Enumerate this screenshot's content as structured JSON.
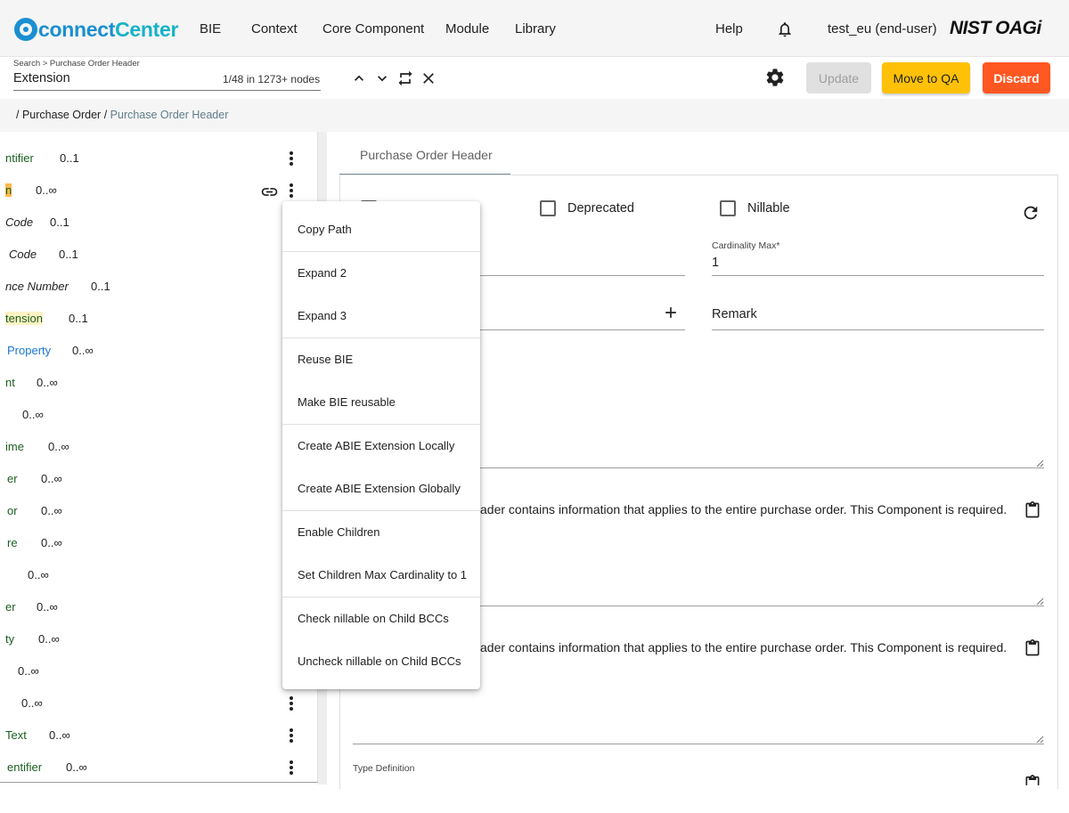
{
  "app": {
    "logo_part1": "connect",
    "logo_part2": "Center",
    "brand_colors": {
      "primary": "#1a8fd1",
      "accent": "#16b3c8"
    }
  },
  "nav": {
    "items": [
      "BIE",
      "Context",
      "Core Component",
      "Module",
      "Library"
    ],
    "help": "Help",
    "user": "test_eu (end-user)",
    "org_logo": "NIST OAGi"
  },
  "search": {
    "caption": "Search > Purchase Order Header",
    "value": "Extension",
    "count": "1/48 in 1273+ nodes"
  },
  "toolbar": {
    "update_label": "Update",
    "qa_label": "Move to QA",
    "discard_label": "Discard",
    "colors": {
      "qa": "#ffc107",
      "discard": "#ff5722",
      "update_disabled": "#e0e0e0"
    }
  },
  "breadcrumb": {
    "sep": "/",
    "parent": "Purchase Order",
    "current": "Purchase Order Header"
  },
  "tree": {
    "rows": [
      {
        "name": "ntifier",
        "card": "0..1"
      },
      {
        "name": "n",
        "card": "0..∞"
      },
      {
        "name": "Code",
        "card": "0..1"
      },
      {
        "name": "Code",
        "card": "0..1"
      },
      {
        "name": "nce Number",
        "card": "0..1"
      },
      {
        "name": "tension",
        "card": "0..1"
      },
      {
        "name": "Property",
        "card": "0..∞"
      },
      {
        "name": "nt",
        "card": "0..∞"
      },
      {
        "name": "",
        "card": "0..∞"
      },
      {
        "name": "ime",
        "card": "0..∞"
      },
      {
        "name": "er",
        "card": "0..∞"
      },
      {
        "name": "or",
        "card": "0..∞"
      },
      {
        "name": "re",
        "card": "0..∞"
      },
      {
        "name": "",
        "card": "0..∞"
      },
      {
        "name": "er",
        "card": "0..∞"
      },
      {
        "name": "ty",
        "card": "0..∞"
      },
      {
        "name": "",
        "card": "0..∞"
      },
      {
        "name": "",
        "card": "0..∞"
      },
      {
        "name": "Text",
        "card": "0..∞"
      },
      {
        "name": "entifier",
        "card": "0..∞"
      }
    ]
  },
  "detail": {
    "tab": "Purchase Order Header",
    "deprecated_label": "Deprecated",
    "nillable_label": "Nillable",
    "card_max_label": "Cardinality Max*",
    "card_max_value": "1",
    "remark_placeholder": "Remark",
    "definition_text": "ader contains information that applies to the entire purchase order.  This Component is required.",
    "definition_text_2": "ader contains information that applies to the entire purchase order.  This Component is required.",
    "type_definition_label": "Type Definition"
  },
  "context_menu": {
    "items": [
      "Copy Path",
      "Expand 2",
      "Expand 3",
      "Reuse BIE",
      "Make BIE reusable",
      "Create ABIE Extension Locally",
      "Create ABIE Extension Globally",
      "Enable Children",
      "Set Children Max Cardinality to 1",
      "Check nillable on Child BCCs",
      "Uncheck nillable on Child BCCs"
    ]
  }
}
